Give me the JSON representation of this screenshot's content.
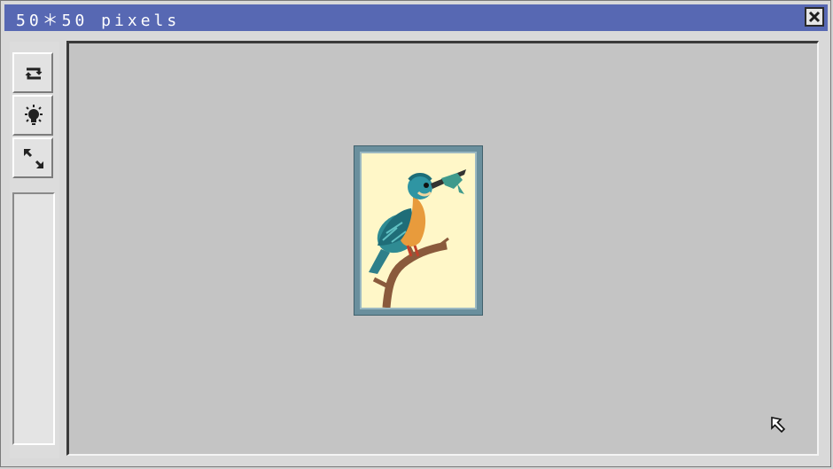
{
  "window": {
    "title": "50＊50 pixels",
    "close_icon": "close-icon"
  },
  "toolbar": {
    "buttons": [
      {
        "name": "refresh-icon"
      },
      {
        "name": "lightbulb-icon"
      },
      {
        "name": "resize-arrows-icon"
      }
    ]
  },
  "canvas": {
    "image": "kingfisher-on-branch",
    "cursor_icon": "arrow-cursor-icon"
  },
  "colors": {
    "titlebar": "#5768b3",
    "canvas_bg": "#c4c4c4",
    "frame": "#6a8f9d",
    "paper": "#fff7c8"
  }
}
